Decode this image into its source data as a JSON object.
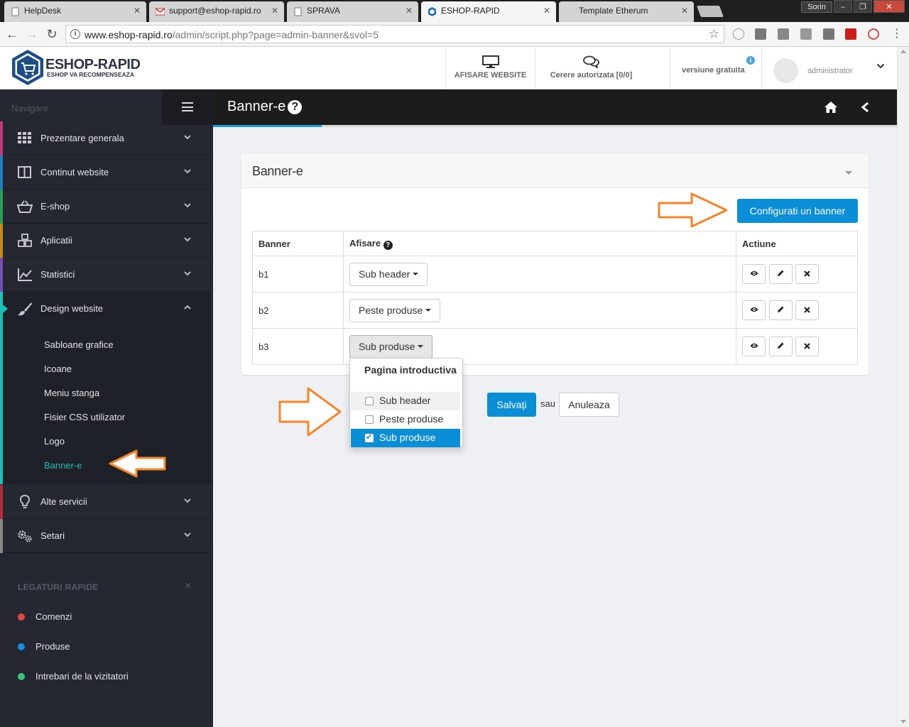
{
  "browser": {
    "tabs": [
      {
        "title": "HelpDesk"
      },
      {
        "title": "support@eshop-rapid.ro"
      },
      {
        "title": "SPRAVA"
      },
      {
        "title": "ESHOP-RAPID"
      },
      {
        "title": "Template Etherum"
      }
    ],
    "profile": "Sorin",
    "url_host": "www.eshop-rapid.ro",
    "url_path": "/admin/script.php?page=admin-banner&svol=5"
  },
  "header": {
    "logo_title": "ESHOP-RAPID",
    "logo_subtitle": "ESHOP VA RECOMPENSEAZA",
    "afisare_website": "AFISARE WEBSITE",
    "cerere": "Cerere autorizata [0/0]",
    "versiune": "versiune gratuita",
    "user": "administrator"
  },
  "sidebar": {
    "nav_label": "Navigare",
    "items": [
      {
        "label": "Prezentare generala",
        "color": "#c0397b"
      },
      {
        "label": "Continut website",
        "color": "#1f7fc1"
      },
      {
        "label": "E-shop",
        "color": "#27a057"
      },
      {
        "label": "Aplicatii",
        "color": "#c98a1c"
      },
      {
        "label": "Statistici",
        "color": "#7a4db5"
      },
      {
        "label": "Design website",
        "color": "#1bbfb5"
      },
      {
        "label": "Alte servicii",
        "color": "#b12d3d"
      },
      {
        "label": "Setari",
        "color": "#888888"
      }
    ],
    "submenu": [
      "Sabloane grafice",
      "Icoane",
      "Meniu stanga",
      "Fisier CSS utilizator",
      "Logo",
      "Banner-e"
    ],
    "quick_title": "LEGATURI RAPIDE",
    "quick": [
      {
        "label": "Comenzi",
        "color": "#e04848"
      },
      {
        "label": "Produse",
        "color": "#1a8ee0"
      },
      {
        "label": "Intrebari de la vizitatori",
        "color": "#37c47a"
      }
    ]
  },
  "page": {
    "title": "Banner-e",
    "panel_title": "Banner-e",
    "config_button": "Configurati un banner",
    "table": {
      "headers": [
        "Banner",
        "Afisare",
        "Actiune"
      ],
      "rows": [
        {
          "banner": "b1",
          "afisare": "Sub header"
        },
        {
          "banner": "b2",
          "afisare": "Peste produse"
        },
        {
          "banner": "b3",
          "afisare": "Sub produse"
        }
      ]
    },
    "dropdown": {
      "header": "Pagina introductiva",
      "options": [
        {
          "label": "Sub header",
          "checked": false
        },
        {
          "label": "Peste produse",
          "checked": false
        },
        {
          "label": "Sub produse",
          "checked": true
        }
      ]
    },
    "save": "Salvați",
    "or": "sau",
    "cancel": "Anuleaza"
  }
}
